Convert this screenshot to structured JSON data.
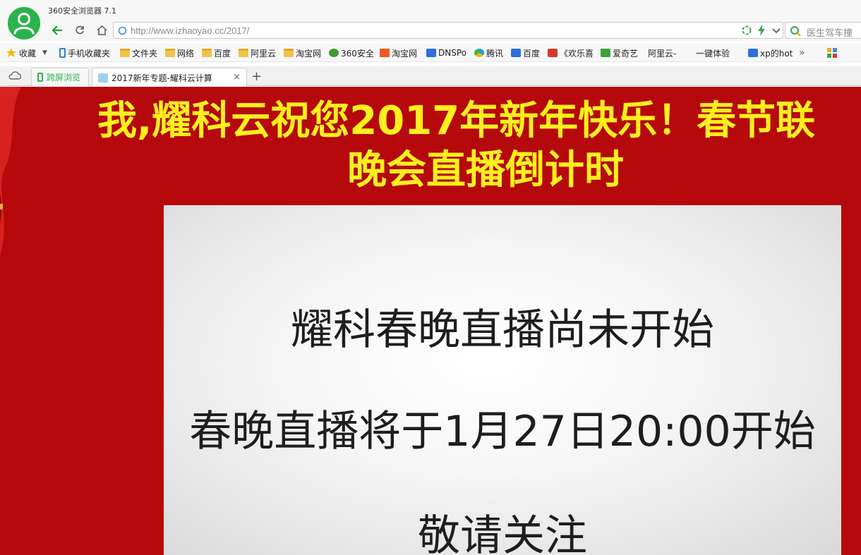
{
  "window": {
    "app_title": "360安全浏览器 7.1"
  },
  "address_bar": {
    "url": "http://www.izhaoyao.cc/2017/",
    "search_text": "医生驾车撞"
  },
  "bookmarks": {
    "items": [
      {
        "label": "收藏",
        "icon": "star-icon"
      },
      {
        "label": "手机收藏夹",
        "icon": "phone-icon"
      },
      {
        "label": "文件夹",
        "icon": "folder-icon"
      },
      {
        "label": "网络",
        "icon": "folder-icon"
      },
      {
        "label": "百度",
        "icon": "folder-icon"
      },
      {
        "label": "阿里云",
        "icon": "folder-icon"
      },
      {
        "label": "淘宝网",
        "icon": "folder-icon"
      },
      {
        "label": "360安全",
        "icon": "360-icon"
      },
      {
        "label": "淘宝网",
        "icon": "taobao-icon"
      },
      {
        "label": "DNSPo",
        "icon": "dnspod-icon"
      },
      {
        "label": "腾讯",
        "icon": "qq-icon"
      },
      {
        "label": "百度",
        "icon": "baidu-paw-icon"
      },
      {
        "label": "《欢乐喜",
        "icon": "letv-icon"
      },
      {
        "label": "爱奇艺",
        "icon": "iqiyi-icon"
      },
      {
        "label": "阿里云-",
        "icon": "page-icon"
      },
      {
        "label": "一键体验",
        "icon": "page-icon"
      },
      {
        "label": "xp的hot",
        "icon": "baidu-paw-icon"
      }
    ],
    "overflow_label": "»"
  },
  "tabs": {
    "items": [
      {
        "label": "跨屏浏览",
        "active": false
      },
      {
        "label": "2017新年专题-耀科云计算",
        "active": true
      }
    ],
    "close_symbol": "×",
    "new_tab_symbol": "+"
  },
  "page": {
    "headline_line1": "我,耀科云祝您2017年新年快乐！春节联",
    "headline_line2": "晚会直播倒计时",
    "message_line1": "耀科春晚直播尚未开始",
    "message_line2": "春晚直播将于1月27日20:00开始",
    "message_line3": "敬请关注"
  },
  "colors": {
    "page_background": "#b5090c",
    "headline_color": "#ffef1e",
    "accent_green": "#2bb24c"
  }
}
